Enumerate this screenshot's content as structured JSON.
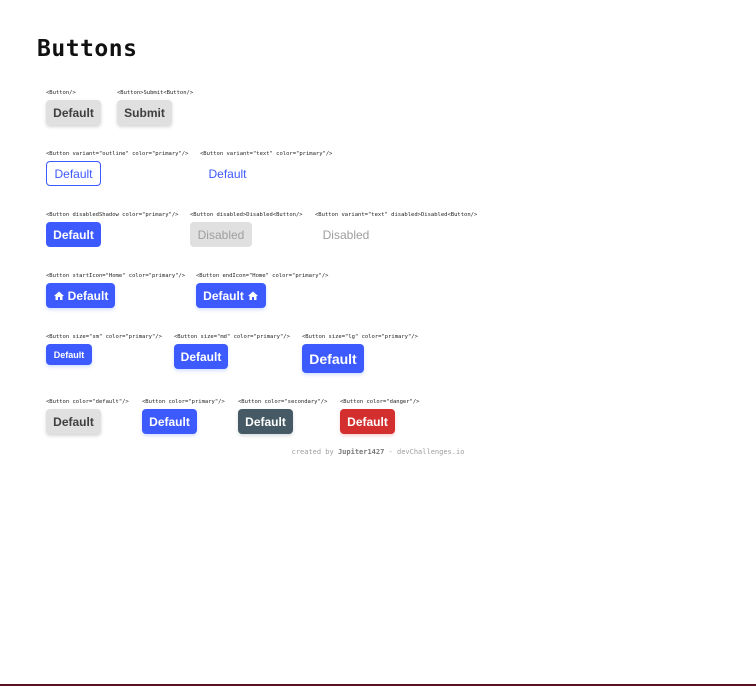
{
  "page": {
    "title": "Buttons"
  },
  "rows": [
    [
      {
        "code": "<Button/>",
        "label": "Default"
      },
      {
        "code": "<Button>Submit<Button/>",
        "label": "Submit"
      }
    ],
    [
      {
        "code": "<Button variant=\"outline\" color=\"primary\"/>",
        "label": "Default"
      },
      {
        "code": "<Button variant=\"text\" color=\"primary\"/>",
        "label": "Default"
      }
    ],
    [
      {
        "code": "<Button disabledShadow color=\"primary\"/>",
        "label": "Default"
      },
      {
        "code": "<Button disabled>Disabled<Button/>",
        "label": "Disabled"
      },
      {
        "code": "<Button variant=\"text\" disabled>Disabled<Button/>",
        "label": "Disabled"
      }
    ],
    [
      {
        "code": "<Button startIcon=\"Home\" color=\"primary\"/>",
        "label": "Default",
        "icon": "home-icon"
      },
      {
        "code": "<Button endIcon=\"Home\" color=\"primary\"/>",
        "label": "Default",
        "icon": "home-icon"
      }
    ],
    [
      {
        "code": "<Button size=\"sm\" color=\"primary\"/>",
        "label": "Default"
      },
      {
        "code": "<Button size=\"md\" color=\"primary\"/>",
        "label": "Default"
      },
      {
        "code": "<Button size=\"lg\" color=\"primary\"/>",
        "label": "Default"
      }
    ],
    [
      {
        "code": "<Button color=\"default\"/>",
        "label": "Default"
      },
      {
        "code": "<Button color=\"primary\"/>",
        "label": "Default"
      },
      {
        "code": "<Button color=\"secondary\"/>",
        "label": "Default"
      },
      {
        "code": "<Button color=\"danger\"/>",
        "label": "Default"
      }
    ]
  ],
  "footer": {
    "prefix": "created by",
    "author": "Jupiter1427",
    "suffix": "- devChallenges.io"
  },
  "colors": {
    "default": "#e0e0e0",
    "primary": "#3d5afe",
    "secondary": "#455a64",
    "danger": "#d32f2f",
    "disabled_text": "#9e9e9e"
  }
}
